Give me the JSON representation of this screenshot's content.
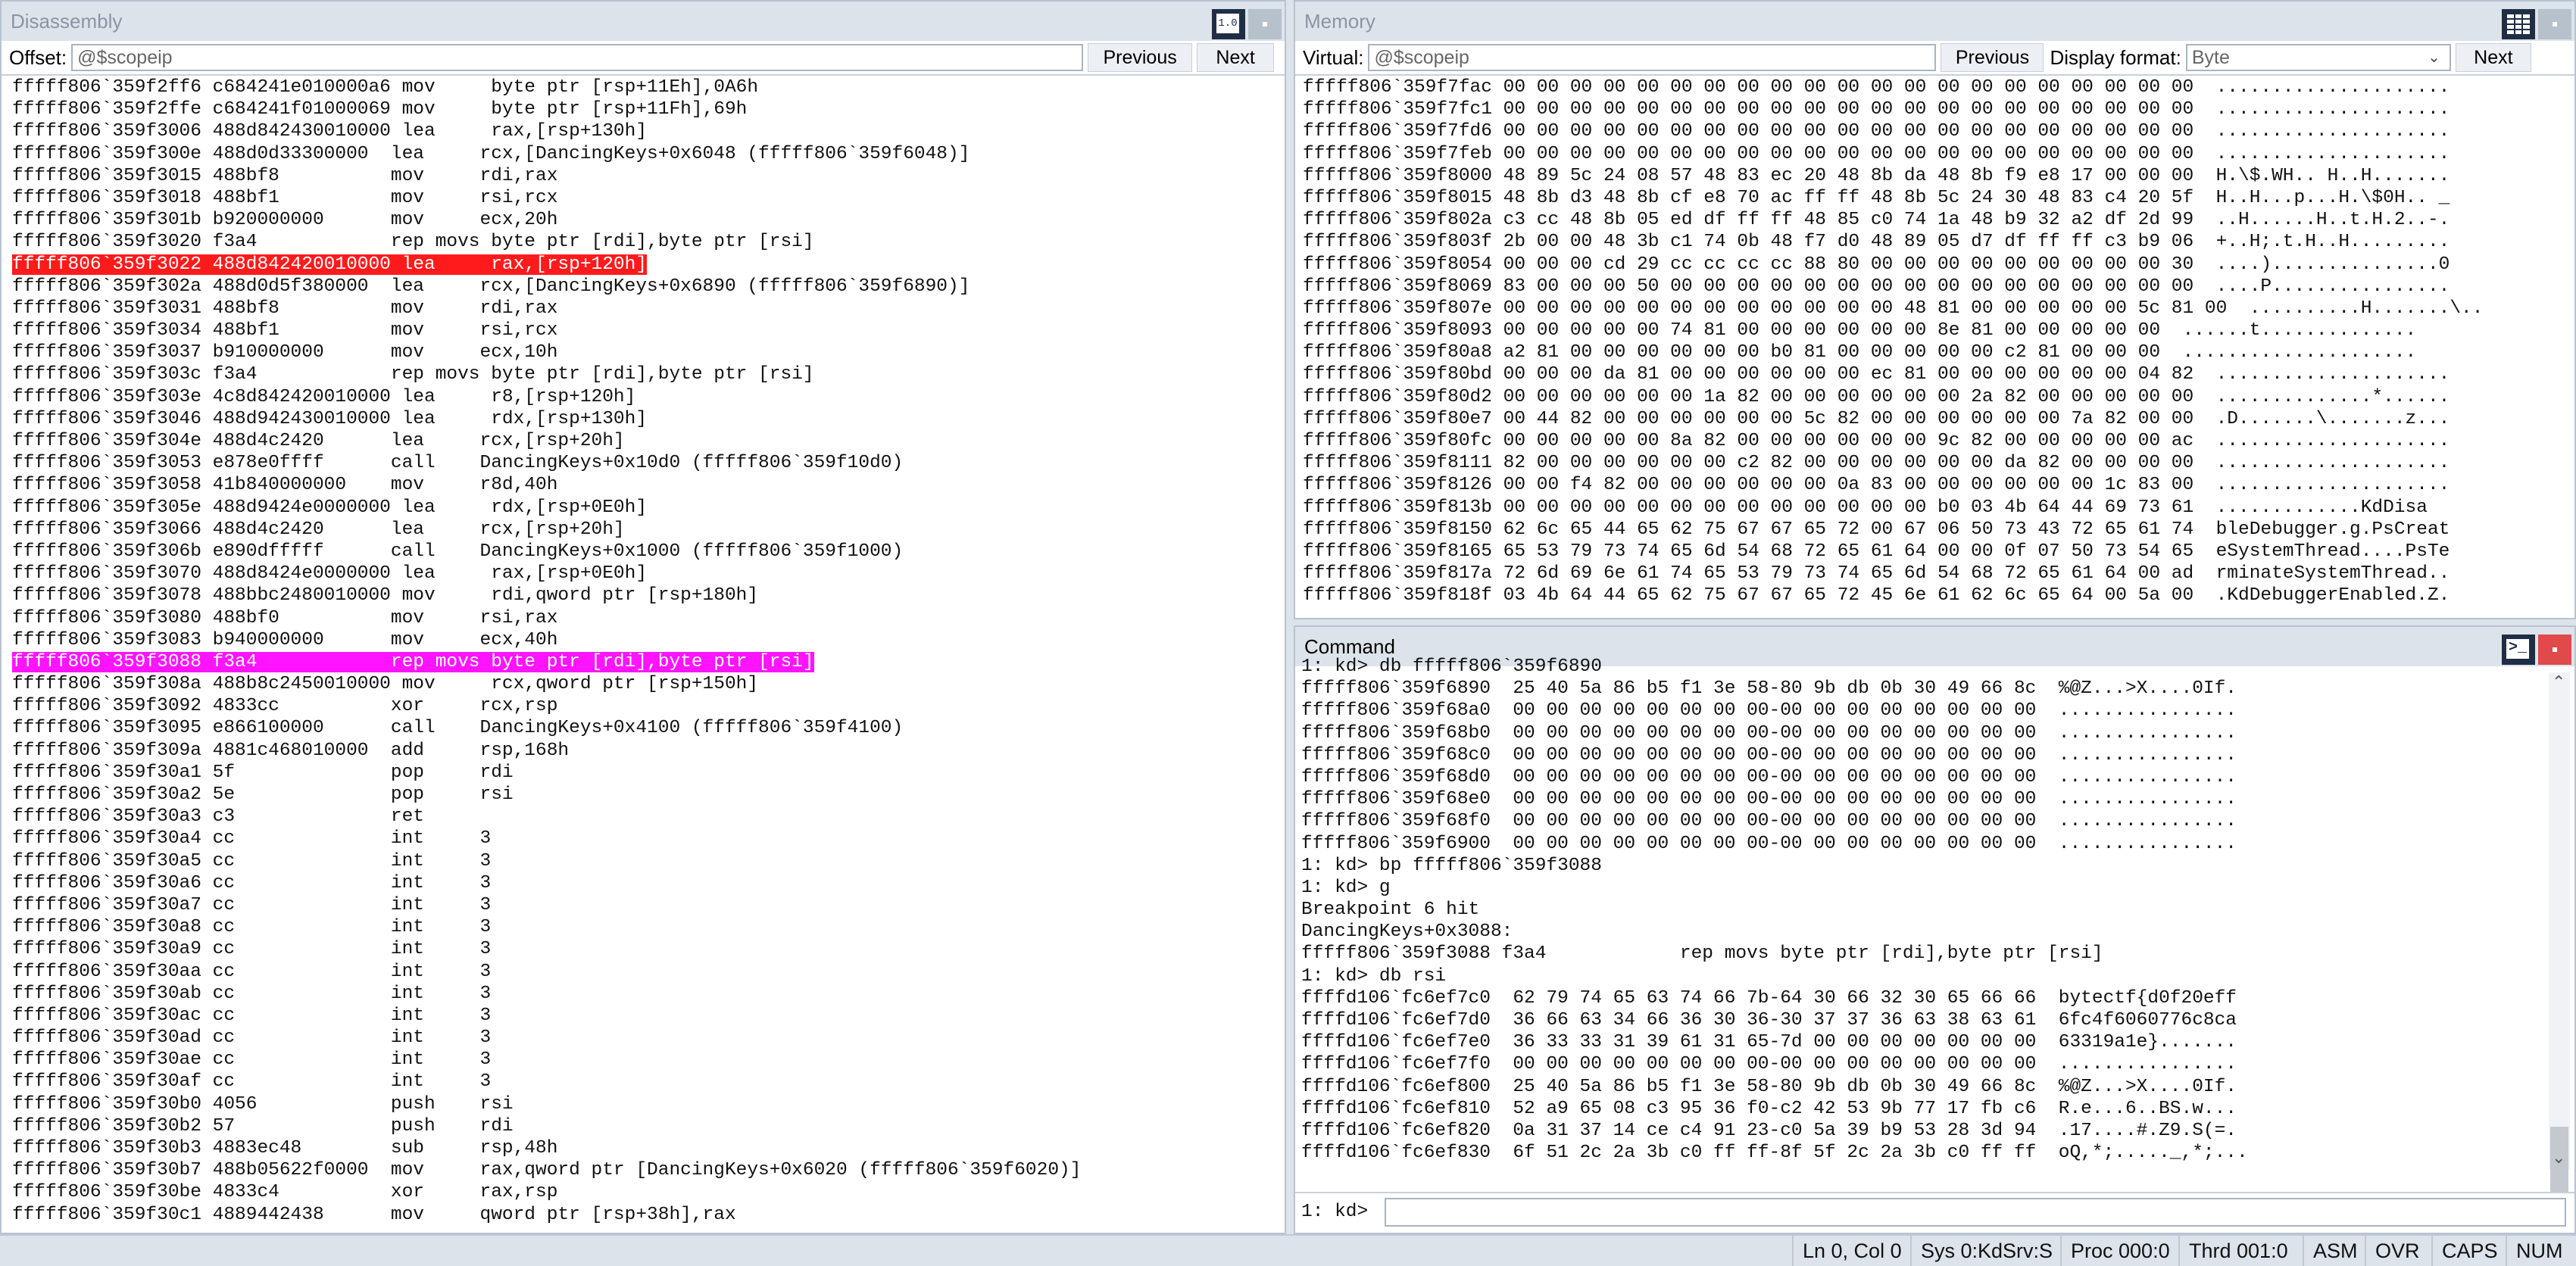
{
  "disasm": {
    "title": "Disassembly",
    "offset_label": "Offset:",
    "offset_value": "@$scopeip",
    "prev_label": "Previous",
    "next_label": "Next",
    "lines": [
      "fffff806`359f2ff6 c684241e010000a6 mov     byte ptr [rsp+11Eh],0A6h",
      "fffff806`359f2ffe c684241f01000069 mov     byte ptr [rsp+11Fh],69h",
      "fffff806`359f3006 488d842430010000 lea     rax,[rsp+130h]",
      "fffff806`359f300e 488d0d33300000  lea     rcx,[DancingKeys+0x6048 (fffff806`359f6048)]",
      "fffff806`359f3015 488bf8          mov     rdi,rax",
      "fffff806`359f3018 488bf1          mov     rsi,rcx",
      "fffff806`359f301b b920000000      mov     ecx,20h",
      "fffff806`359f3020 f3a4            rep movs byte ptr [rdi],byte ptr [rsi]",
      "fffff806`359f3022 488d842420010000 lea     rax,[rsp+120h]",
      "fffff806`359f302a 488d0d5f380000  lea     rcx,[DancingKeys+0x6890 (fffff806`359f6890)]",
      "fffff806`359f3031 488bf8          mov     rdi,rax",
      "fffff806`359f3034 488bf1          mov     rsi,rcx",
      "fffff806`359f3037 b910000000      mov     ecx,10h",
      "fffff806`359f303c f3a4            rep movs byte ptr [rdi],byte ptr [rsi]",
      "fffff806`359f303e 4c8d842420010000 lea     r8,[rsp+120h]",
      "fffff806`359f3046 488d942430010000 lea     rdx,[rsp+130h]",
      "fffff806`359f304e 488d4c2420      lea     rcx,[rsp+20h]",
      "fffff806`359f3053 e878e0ffff      call    DancingKeys+0x10d0 (fffff806`359f10d0)",
      "fffff806`359f3058 41b840000000    mov     r8d,40h",
      "fffff806`359f305e 488d9424e0000000 lea     rdx,[rsp+0E0h]",
      "fffff806`359f3066 488d4c2420      lea     rcx,[rsp+20h]",
      "fffff806`359f306b e890dfffff      call    DancingKeys+0x1000 (fffff806`359f1000)",
      "fffff806`359f3070 488d8424e0000000 lea     rax,[rsp+0E0h]",
      "fffff806`359f3078 488bbc2480010000 mov     rdi,qword ptr [rsp+180h]",
      "fffff806`359f3080 488bf0          mov     rsi,rax",
      "fffff806`359f3083 b940000000      mov     ecx,40h",
      "fffff806`359f3088 f3a4            rep movs byte ptr [rdi],byte ptr [rsi]",
      "fffff806`359f308a 488b8c2450010000 mov     rcx,qword ptr [rsp+150h]",
      "fffff806`359f3092 4833cc          xor     rcx,rsp",
      "fffff806`359f3095 e866100000      call    DancingKeys+0x4100 (fffff806`359f4100)",
      "fffff806`359f309a 4881c468010000  add     rsp,168h",
      "fffff806`359f30a1 5f              pop     rdi",
      "fffff806`359f30a2 5e              pop     rsi",
      "fffff806`359f30a3 c3              ret",
      "fffff806`359f30a4 cc              int     3",
      "fffff806`359f30a5 cc              int     3",
      "fffff806`359f30a6 cc              int     3",
      "fffff806`359f30a7 cc              int     3",
      "fffff806`359f30a8 cc              int     3",
      "fffff806`359f30a9 cc              int     3",
      "fffff806`359f30aa cc              int     3",
      "fffff806`359f30ab cc              int     3",
      "fffff806`359f30ac cc              int     3",
      "fffff806`359f30ad cc              int     3",
      "fffff806`359f30ae cc              int     3",
      "fffff806`359f30af cc              int     3",
      "fffff806`359f30b0 4056            push    rsi",
      "fffff806`359f30b2 57              push    rdi",
      "fffff806`359f30b3 4883ec48        sub     rsp,48h",
      "fffff806`359f30b7 488b05622f0000  mov     rax,qword ptr [DancingKeys+0x6020 (fffff806`359f6020)]",
      "fffff806`359f30be 4833c4          xor     rax,rsp",
      "fffff806`359f30c1 4889442438      mov     qword ptr [rsp+38h],rax"
    ],
    "highlight_breakpoint": "fffff806`359f3022 488d842420010000 lea     rax,[rsp+120h]",
    "highlight_current": "fffff806`359f3088 f3a4            rep movs byte ptr [rdi],byte ptr [rsi]"
  },
  "memory": {
    "title": "Memory",
    "virtual_label": "Virtual:",
    "virtual_value": "@$scopeip",
    "prev_label": "Previous",
    "format_label": "Display format:",
    "format_value": "Byte",
    "next_label": "Next",
    "lines": [
      "fffff806`359f7fac 00 00 00 00 00 00 00 00 00 00 00 00 00 00 00 00 00 00 00 00 00  .....................",
      "fffff806`359f7fc1 00 00 00 00 00 00 00 00 00 00 00 00 00 00 00 00 00 00 00 00 00  .....................",
      "fffff806`359f7fd6 00 00 00 00 00 00 00 00 00 00 00 00 00 00 00 00 00 00 00 00 00  .....................",
      "fffff806`359f7feb 00 00 00 00 00 00 00 00 00 00 00 00 00 00 00 00 00 00 00 00 00  .....................",
      "fffff806`359f8000 48 89 5c 24 08 57 48 83 ec 20 48 8b da 48 8b f9 e8 17 00 00 00  H.\\$.WH.. H..H.......",
      "fffff806`359f8015 48 8b d3 48 8b cf e8 70 ac ff ff 48 8b 5c 24 30 48 83 c4 20 5f  H..H...p...H.\\$0H.. _",
      "fffff806`359f802a c3 cc 48 8b 05 ed df ff ff 48 85 c0 74 1a 48 b9 32 a2 df 2d 99  ..H......H..t.H.2..-.",
      "fffff806`359f803f 2b 00 00 48 3b c1 74 0b 48 f7 d0 48 89 05 d7 df ff ff c3 b9 06  +..H;.t.H..H.........",
      "fffff806`359f8054 00 00 00 cd 29 cc cc cc cc 88 80 00 00 00 00 00 00 00 00 00 30  ....)...............0",
      "fffff806`359f8069 83 00 00 00 50 00 00 00 00 00 00 00 00 00 00 00 00 00 00 00 00  ....P................",
      "fffff806`359f807e 00 00 00 00 00 00 00 00 00 00 00 00 48 81 00 00 00 00 00 5c 81 00  ..........H.......\\..",
      "fffff806`359f8093 00 00 00 00 00 74 81 00 00 00 00 00 00 8e 81 00 00 00 00 00  ......t..............",
      "fffff806`359f80a8 a2 81 00 00 00 00 00 00 b0 81 00 00 00 00 00 c2 81 00 00 00  .....................",
      "fffff806`359f80bd 00 00 00 da 81 00 00 00 00 00 00 ec 81 00 00 00 00 00 00 04 82  .....................",
      "fffff806`359f80d2 00 00 00 00 00 00 1a 82 00 00 00 00 00 00 2a 82 00 00 00 00 00  ..............*......",
      "fffff806`359f80e7 00 44 82 00 00 00 00 00 00 5c 82 00 00 00 00 00 00 7a 82 00 00  .D.......\\.......z...",
      "fffff806`359f80fc 00 00 00 00 00 8a 82 00 00 00 00 00 00 9c 82 00 00 00 00 00 ac  .....................",
      "fffff806`359f8111 82 00 00 00 00 00 00 c2 82 00 00 00 00 00 00 da 82 00 00 00 00  .....................",
      "fffff806`359f8126 00 00 f4 82 00 00 00 00 00 00 0a 83 00 00 00 00 00 00 1c 83 00  .....................",
      "fffff806`359f813b 00 00 00 00 00 00 00 00 00 00 00 00 00 b0 03 4b 64 44 69 73 61  .............KdDisa",
      "fffff806`359f8150 62 6c 65 44 65 62 75 67 67 65 72 00 67 06 50 73 43 72 65 61 74  bleDebugger.g.PsCreat",
      "fffff806`359f8165 65 53 79 73 74 65 6d 54 68 72 65 61 64 00 00 0f 07 50 73 54 65  eSystemThread....PsTe",
      "fffff806`359f817a 72 6d 69 6e 61 74 65 53 79 73 74 65 6d 54 68 72 65 61 64 00 ad  rminateSystemThread..",
      "fffff806`359f818f 03 4b 64 44 65 62 75 67 67 65 72 45 6e 61 62 6c 65 64 00 5a 00  .KdDebuggerEnabled.Z."
    ]
  },
  "command": {
    "title": "Command",
    "lines": [
      "1: kd> db fffff806`359f6890",
      "fffff806`359f6890  25 40 5a 86 b5 f1 3e 58-80 9b db 0b 30 49 66 8c  %@Z...>X....0If.",
      "fffff806`359f68a0  00 00 00 00 00 00 00 00-00 00 00 00 00 00 00 00  ................",
      "fffff806`359f68b0  00 00 00 00 00 00 00 00-00 00 00 00 00 00 00 00  ................",
      "fffff806`359f68c0  00 00 00 00 00 00 00 00-00 00 00 00 00 00 00 00  ................",
      "fffff806`359f68d0  00 00 00 00 00 00 00 00-00 00 00 00 00 00 00 00  ................",
      "fffff806`359f68e0  00 00 00 00 00 00 00 00-00 00 00 00 00 00 00 00  ................",
      "fffff806`359f68f0  00 00 00 00 00 00 00 00-00 00 00 00 00 00 00 00  ................",
      "fffff806`359f6900  00 00 00 00 00 00 00 00-00 00 00 00 00 00 00 00  ................",
      "1: kd> bp fffff806`359f3088",
      "1: kd> g",
      "Breakpoint 6 hit",
      "DancingKeys+0x3088:",
      "fffff806`359f3088 f3a4            rep movs byte ptr [rdi],byte ptr [rsi]",
      "1: kd> db rsi",
      "ffffd106`fc6ef7c0  62 79 74 65 63 74 66 7b-64 30 66 32 30 65 66 66  bytectf{d0f20eff",
      "ffffd106`fc6ef7d0  36 66 63 34 66 36 30 36-30 37 37 36 63 38 63 61  6fc4f6060776c8ca",
      "ffffd106`fc6ef7e0  36 33 33 31 39 61 31 65-7d 00 00 00 00 00 00 00  63319a1e}.......",
      "ffffd106`fc6ef7f0  00 00 00 00 00 00 00 00-00 00 00 00 00 00 00 00  ................",
      "ffffd106`fc6ef800  25 40 5a 86 b5 f1 3e 58-80 9b db 0b 30 49 66 8c  %@Z...>X....0If.",
      "ffffd106`fc6ef810  52 a9 65 08 c3 95 36 f0-c2 42 53 9b 77 17 fb c6  R.e...6..BS.w...",
      "ffffd106`fc6ef820  0a 31 37 14 ce c4 91 23-c0 5a 39 b9 53 28 3d 94  .17....#.Z9.S(=.",
      "ffffd106`fc6ef830  6f 51 2c 2a 3b c0 ff ff-8f 5f 2c 2a 3b c0 ff ff  oQ,*;....._,*;..."
    ],
    "prompt": "1: kd>"
  },
  "statusbar": {
    "position": "Ln 0, Col 0",
    "sys": "Sys 0:KdSrv:S",
    "proc": "Proc 000:0",
    "thrd": "Thrd 001:0",
    "asm": "ASM",
    "ovr": "OVR",
    "caps": "CAPS",
    "num": "NUM"
  },
  "colors": {
    "breakpoint_highlight": "#ff1b1b",
    "current_highlight": "#ff14ff",
    "pane_title": "#8a95a3",
    "chrome": "#dde3ea"
  }
}
